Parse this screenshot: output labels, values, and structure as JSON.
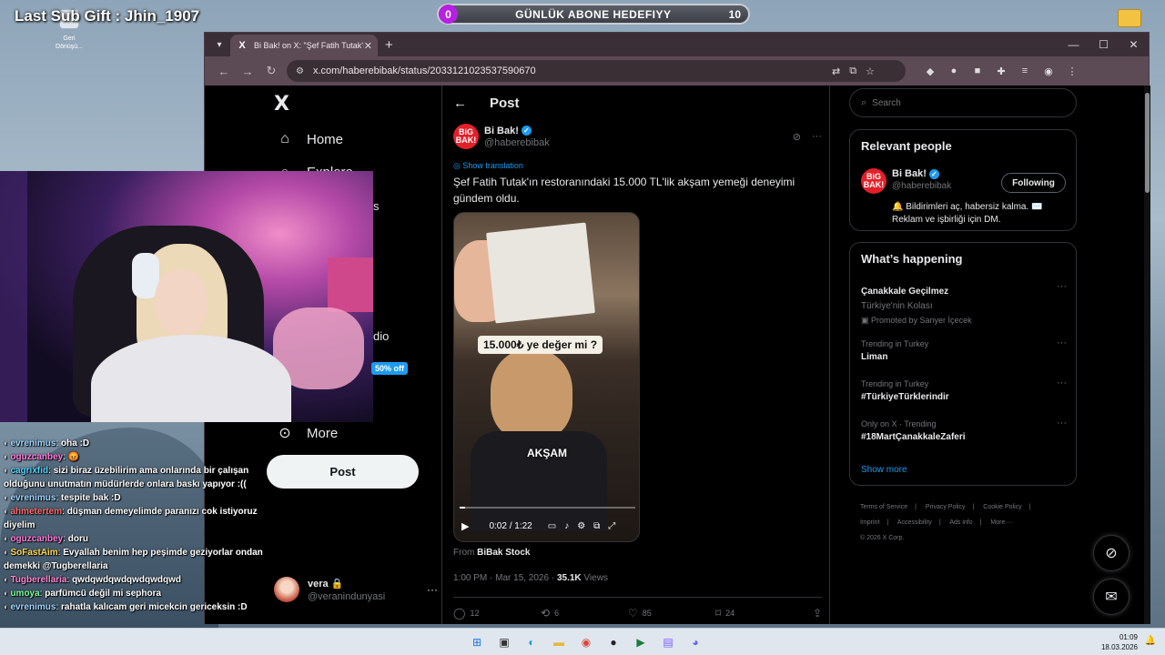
{
  "overlay": {
    "last_sub": "Last Sub Gift : Jhin_1907",
    "goal": {
      "label": "GÜNLÜK ABONE HEDEFIYY",
      "current": "0",
      "target": "10",
      "progress": 0.0
    },
    "desktop_icon_label": "Geri Dönüşü..."
  },
  "browser": {
    "tab_title": "Bi Bak! on X: \"Şef Fatih Tutak'ın res",
    "tab_favicon": "X",
    "url": "x.com/haberebibak/status/2033121023537590670"
  },
  "nav": {
    "logo": "X",
    "items": [
      {
        "label": "Home",
        "icon": "home-icon"
      },
      {
        "label": "Explore",
        "icon": "search-icon"
      },
      {
        "label": "More",
        "icon": "more-circle-icon"
      }
    ],
    "peek_labels": [
      "s",
      "dio"
    ],
    "promo_tag": "50% off",
    "post_button": "Post",
    "account": {
      "name": "vera 🔒",
      "handle": "@veranindunyasi"
    }
  },
  "post": {
    "header": "Post",
    "author": {
      "name": "Bi Bak!",
      "handle": "@haberebibak",
      "logo_text": "BiG BAK!"
    },
    "show_translation": "Show translation",
    "text": "Şef Fatih Tutak'ın restoranındaki 15.000 TL'lik akşam yemeği deneyimi gündem oldu.",
    "video": {
      "caption_top": "15.000₺ ye değer mi ?",
      "caption_mid": "AKŞAM",
      "time": "0:02 / 1:22",
      "progress": 0.03
    },
    "from_prefix": "From",
    "from_source": "BiBak Stock",
    "timestamp": "1:00 PM · Mar 15, 2026 · ",
    "views_count": "35.1K",
    "views_label": " Views",
    "actions": {
      "replies": "12",
      "reposts": "6",
      "likes": "85",
      "bookmarks": "24"
    }
  },
  "sidebar": {
    "search_placeholder": "Search",
    "relevant": {
      "title": "Relevant people",
      "name": "Bi Bak!",
      "handle": "@haberebibak",
      "follow_label": "Following",
      "bio": "🔔 Bildirimleri aç, habersiz kalma. ✉️ Reklam ve işbirliği için DM."
    },
    "happening": {
      "title": "What’s happening",
      "trends": [
        {
          "context": "",
          "title": "Çanakkale Geçilmez",
          "sub": "Türkiye'nin Kolası",
          "promo": "Promoted by Sanyer İçecek"
        },
        {
          "context": "Trending in Turkey",
          "title": "Liman"
        },
        {
          "context": "Trending in Turkey",
          "title": "#TürkiyeTürklerindir"
        },
        {
          "context": "Only on X · Trending",
          "title": "#18MartÇanakkaleZaferi"
        }
      ],
      "show_more": "Show more"
    },
    "footer": [
      "Terms of Service",
      "|",
      "Privacy Policy",
      "|",
      "Cookie Policy",
      "|",
      "Imprint",
      "|",
      "Accessibility",
      "|",
      "Ads info",
      "|",
      "More ···",
      "© 2026 X Corp."
    ]
  },
  "chat": [
    {
      "user": "evrenimus",
      "text": "oha :D",
      "color": "#9fd6ff"
    },
    {
      "user": "oguzcanbey",
      "text": "😡",
      "color": "#ff7ad9"
    },
    {
      "user": "cagrixfid",
      "text": "sizi biraz üzebilirim ama onlarında bir çalışan olduğunu unutmatın müdürlerde onlara baskı yapıyor :((",
      "color": "#4fd1ff"
    },
    {
      "user": "evrenimus",
      "text": "tespite bak :D",
      "color": "#9fd6ff"
    },
    {
      "user": "ahmetertem",
      "text": "düşman demeyelimde paranızı cok istiyoruz diyelim",
      "color": "#ff6b6b"
    },
    {
      "user": "oguzcanbey",
      "text": "doru",
      "color": "#ff7ad9"
    },
    {
      "user": "SoFastAim",
      "text": "Evyallah benim hep peşimde geziyorlar ondan demekki @Tugberellaria",
      "color": "#ffd84d"
    },
    {
      "user": "Tugberellaria",
      "text": "qwdqwdqwdqwdqwdqwd",
      "color": "#ff8ad6"
    },
    {
      "user": "umoya",
      "text": "parfümcü değil mi sephora",
      "color": "#7aff9a"
    },
    {
      "user": "evrenimus",
      "text": "rahatla kalıcam geri micekcin gericeksin :D",
      "color": "#9fd6ff"
    }
  ],
  "taskbar": {
    "time": "01:09",
    "date": "18.03.2026",
    "apps": [
      "windows-start-icon",
      "task-view-icon",
      "edge-icon",
      "explorer-icon",
      "chrome-icon",
      "obs-icon",
      "terminal-icon",
      "app-icon",
      "discord-icon"
    ]
  }
}
